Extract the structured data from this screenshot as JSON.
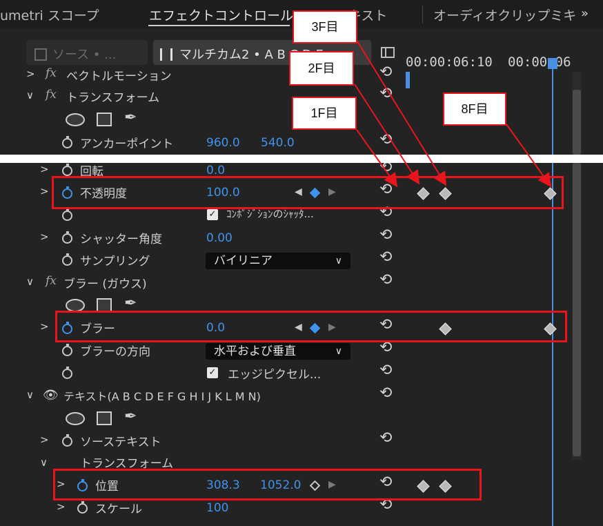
{
  "tabs": [
    {
      "label": "umetri スコープ"
    },
    {
      "label": "エフェクトコントロール"
    },
    {
      "label": "キスト"
    },
    {
      "label": "オーディオクリップミキ"
    }
  ],
  "tab_overflow": "»",
  "source_button": "ソース • ...",
  "clip_button": "マルチカム2 • A B C D E",
  "timecodes": [
    "00:00:06:10",
    "00:00:06"
  ],
  "rows_top": {
    "vector_motion": "ベクトルモーション",
    "transform": "トランスフォーム",
    "anchor_label": "アンカーポイント",
    "anchor_x": "960.0",
    "anchor_y": "540.0"
  },
  "rows_bottom": {
    "rotation_label": "回転",
    "rotation_value": "0.0",
    "opacity_label": "不透明度",
    "opacity_value": "100.0",
    "composite_shutter": "ｺﾝﾎﾟｼﾞｼｮﾝのｼｬｯﾀ...",
    "shutter_angle_label": "シャッター角度",
    "shutter_angle_value": "0.00",
    "sampling_label": "サンプリング",
    "sampling_value": "バイリニア",
    "blur_effect": "ブラー (ガウス)",
    "blur_label": "ブラー",
    "blur_value": "0.0",
    "blur_direction_label": "ブラーの方向",
    "blur_direction_value": "水平および垂直",
    "edge_pixels": "エッジピクセル...",
    "text_layer": "テキスト(A B C D E F G H I J K L M N)",
    "source_text": "ソーステキスト",
    "text_transform": "トランスフォーム",
    "position_label": "位置",
    "position_x": "308.3",
    "position_y": "1052.0",
    "scale_label": "スケール",
    "scale_value": "100"
  },
  "callouts": {
    "f3": "3F目",
    "f2": "2F目",
    "f1": "1F目",
    "f8": "8F目"
  },
  "colors": {
    "highlight": "#e8161c",
    "accent": "#3f93ea",
    "panel": "#232323"
  }
}
